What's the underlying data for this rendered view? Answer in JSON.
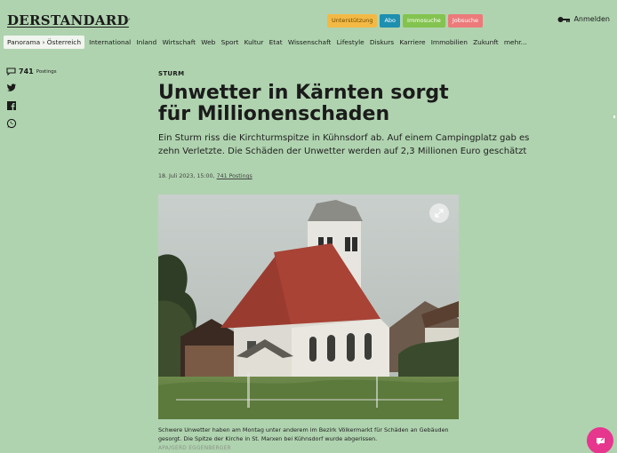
{
  "header": {
    "logo": "DERSTANDARD",
    "pills": [
      "Unterstützung",
      "Abo",
      "Immosuche",
      "Jobsuche"
    ],
    "login_label": "Anmelden",
    "colors": {
      "support": "#f3b945",
      "abo": "#1d8fb0",
      "immo": "#83c34f",
      "jobs": "#ec7a7a",
      "background": "#afd3af",
      "fab": "#e6368e"
    }
  },
  "nav": {
    "active": "Panorama › Österreich",
    "items": [
      "International",
      "Inland",
      "Wirtschaft",
      "Web",
      "Sport",
      "Kultur",
      "Etat",
      "Wissenschaft",
      "Lifestyle",
      "Diskurs",
      "Karriere",
      "Immobilien",
      "Zukunft",
      "mehr..."
    ]
  },
  "social": {
    "postings_count": "741",
    "postings_label": "Postings",
    "icons": [
      "comment-icon",
      "twitter-icon",
      "facebook-icon",
      "whatsapp-icon"
    ]
  },
  "article": {
    "kicker": "STURM",
    "headline": "Unwetter in Kärnten sorgt für Millionenschaden",
    "lead": "Ein Sturm riss die Kirchturmspitze in Kühnsdorf ab. Auf einem Campingplatz gab es zehn Verletzte. Die Schäden der Unwetter werden auf 2,3 Millionen Euro geschätzt",
    "date": "18. Juli 2023, 15:00,",
    "postings_link": "741 Postings",
    "caption": "Schwere Unwetter haben am Montag unter anderem im Bezirk Völkermarkt für Schäden an Gebäuden gesorgt. Die Spitze der Kirche in St. Marxen bei Kühnsdorf wurde abgerissen.",
    "credit": "APA/GERD EGGENBERGER"
  }
}
